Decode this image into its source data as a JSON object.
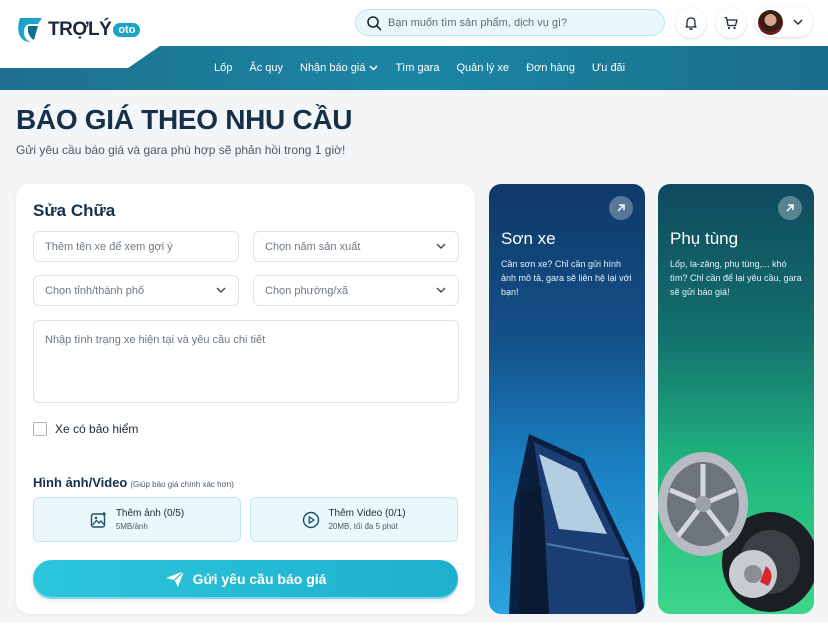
{
  "header": {
    "logo_text": "TRỢLÝ",
    "logo_badge": "oto",
    "search_placeholder": "Bạn muốn tìm sản phẩm, dịch vụ gì?",
    "icons": [
      "bell-icon",
      "cart-icon",
      "chevron-down-icon"
    ]
  },
  "nav": {
    "items": [
      {
        "label": "Lốp"
      },
      {
        "label": "Ắc quy"
      },
      {
        "label": "Nhận báo giá"
      },
      {
        "label": "Tìm gara"
      },
      {
        "label": "Quản lý xe"
      },
      {
        "label": "Đơn hàng"
      },
      {
        "label": "Ưu đãi"
      }
    ]
  },
  "page": {
    "title": "BÁO GIÁ THEO NHU CẦU",
    "subtitle": "Gửi yêu cầu báo giá và gara phù hợp sẽ phản hồi trong 1 giờ!"
  },
  "form": {
    "title": "Sửa Chữa",
    "car_name_placeholder": "Thêm tên xe để xem gợi ý",
    "year_placeholder": "Chọn năm sản xuất",
    "province_placeholder": "Chọn tỉnh/thành phố",
    "ward_placeholder": "Chọn phường/xã",
    "detail_placeholder": "Nhập tình trạng xe hiện tại và yêu cầu chi tiết",
    "insurance_label": "Xe có bảo hiểm",
    "media_title": "Hình ảnh/Video",
    "media_note": "(Giúp báo giá chính xác hơn)",
    "add_image_label": "Thêm ảnh (0/5)",
    "add_image_limit": "5MB/ảnh",
    "add_video_label": "Thêm Video (0/1)",
    "add_video_limit": "20MB, tối đa 5 phút",
    "submit_label": "Gửi yêu cầu báo giá"
  },
  "promos": [
    {
      "title": "Sơn xe",
      "desc": "Cần sơn xe? Chỉ cần gửi hình ảnh mô tả, gara sẽ liên hệ lại với bạn!"
    },
    {
      "title": "Phụ tùng",
      "desc": "Lốp, la-zăng, phụ tùng,... khó tìm? Chỉ cần để lại yêu cầu, gara sẽ gửi báo giá!"
    }
  ],
  "colors": {
    "accent": "#1fb0cc",
    "nav_bg": "#1b86a4",
    "title": "#16304a"
  }
}
